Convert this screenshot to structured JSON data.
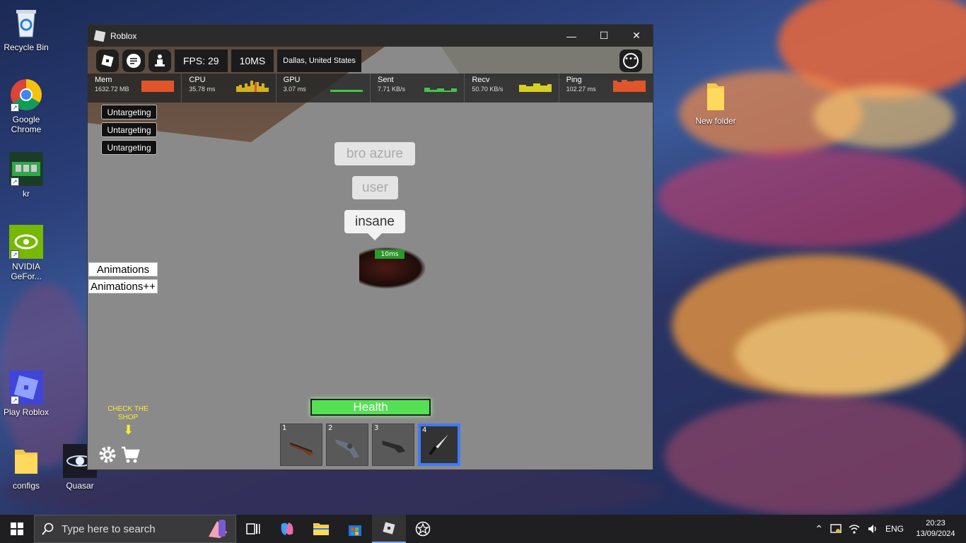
{
  "desktop": {
    "icons": [
      {
        "label": "Recycle Bin",
        "icon": "recycle-bin-icon"
      },
      {
        "label": "Google Chrome",
        "icon": "chrome-icon"
      },
      {
        "label": "kr",
        "icon": "ram-icon"
      },
      {
        "label": "NVIDIA GeFor...",
        "icon": "nvidia-icon"
      },
      {
        "label": "Play Roblox",
        "icon": "roblox-studio-icon"
      },
      {
        "label": "configs",
        "icon": "folder-icon"
      },
      {
        "label": "Quasar",
        "icon": "quasar-icon"
      },
      {
        "label": "New folder",
        "icon": "folder-icon"
      }
    ]
  },
  "window": {
    "title": "Roblox",
    "minimize": "—",
    "maximize": "☐",
    "close": "✕"
  },
  "game": {
    "topbar": {
      "fps": "FPS: 29",
      "ms": "10MS",
      "server": "Dallas, United States"
    },
    "stats": [
      {
        "name": "Mem",
        "value": "1632.72 MB",
        "color": "#e0552a"
      },
      {
        "name": "CPU",
        "value": "35.78 ms",
        "color": "#d4b21e"
      },
      {
        "name": "GPU",
        "value": "3.07 ms",
        "color": "#45c445"
      },
      {
        "name": "Sent",
        "value": "7.71 KB/s",
        "color": "#45c445"
      },
      {
        "name": "Recv",
        "value": "50.70 KB/s",
        "color": "#d8d020"
      },
      {
        "name": "Ping",
        "value": "102.27 ms",
        "color": "#e0552a"
      }
    ],
    "untargeting": [
      "Untargeting",
      "Untargeting",
      "Untargeting"
    ],
    "chat": [
      "bro azure",
      "user",
      "insane"
    ],
    "player_ping": "10ms",
    "animations": [
      "Animations",
      "Animations++"
    ],
    "health_label": "Health",
    "hotbar": [
      {
        "num": "1",
        "item": "shotgun-icon"
      },
      {
        "num": "2",
        "item": "revolver-icon"
      },
      {
        "num": "3",
        "item": "sawed-off-icon"
      },
      {
        "num": "4",
        "item": "knife-icon"
      }
    ],
    "shop_label": "CHECK THE SHOP",
    "shop_arrow": "⬇"
  },
  "taskbar": {
    "search_placeholder": "Type here to search",
    "language": "ENG",
    "time": "20:23",
    "date": "13/09/2024"
  }
}
